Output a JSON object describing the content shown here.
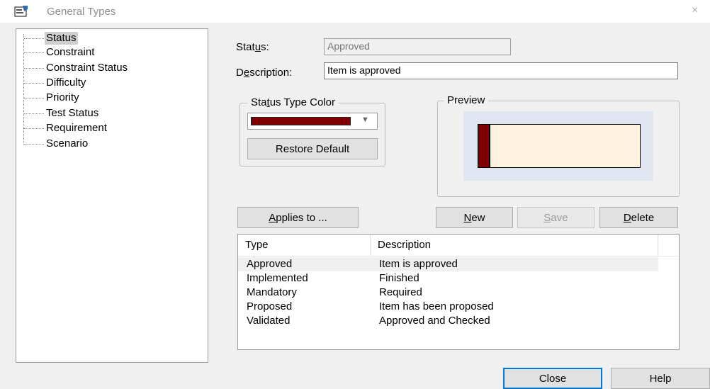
{
  "window": {
    "title": "General Types",
    "close_glyph": "×"
  },
  "tree": {
    "items": [
      "Status",
      "Constraint",
      "Constraint Status",
      "Difficulty",
      "Priority",
      "Test Status",
      "Requirement",
      "Scenario"
    ],
    "selected": "Status"
  },
  "form": {
    "status_label_pre": "Stat",
    "status_label_ul": "u",
    "status_label_post": "s:",
    "status_value": "Approved",
    "description_label_pre": "D",
    "description_label_ul": "e",
    "description_label_post": "scription:",
    "description_value": "Item is approved"
  },
  "color_group": {
    "title_pre": "Sta",
    "title_ul": "t",
    "title_post": "us Type Color",
    "selected_color": "#800000",
    "restore_label": "Restore Default"
  },
  "preview": {
    "title": "Preview",
    "fill_color": "#fff3e0",
    "bar_color": "#800000"
  },
  "buttons": {
    "applies_ul": "A",
    "applies_post": "pplies to ...",
    "new_ul": "N",
    "new_post": "ew",
    "save_ul": "S",
    "save_post": "ave",
    "delete_ul": "D",
    "delete_post": "elete",
    "close": "Close",
    "help": "Help"
  },
  "list": {
    "columns": [
      "Type",
      "Description"
    ],
    "rows": [
      {
        "type": "Approved",
        "description": "Item is approved"
      },
      {
        "type": "Implemented",
        "description": "Finished"
      },
      {
        "type": "Mandatory",
        "description": "Required"
      },
      {
        "type": "Proposed",
        "description": "Item has been proposed"
      },
      {
        "type": "Validated",
        "description": "Approved and Checked"
      }
    ],
    "selected_index": 0
  }
}
